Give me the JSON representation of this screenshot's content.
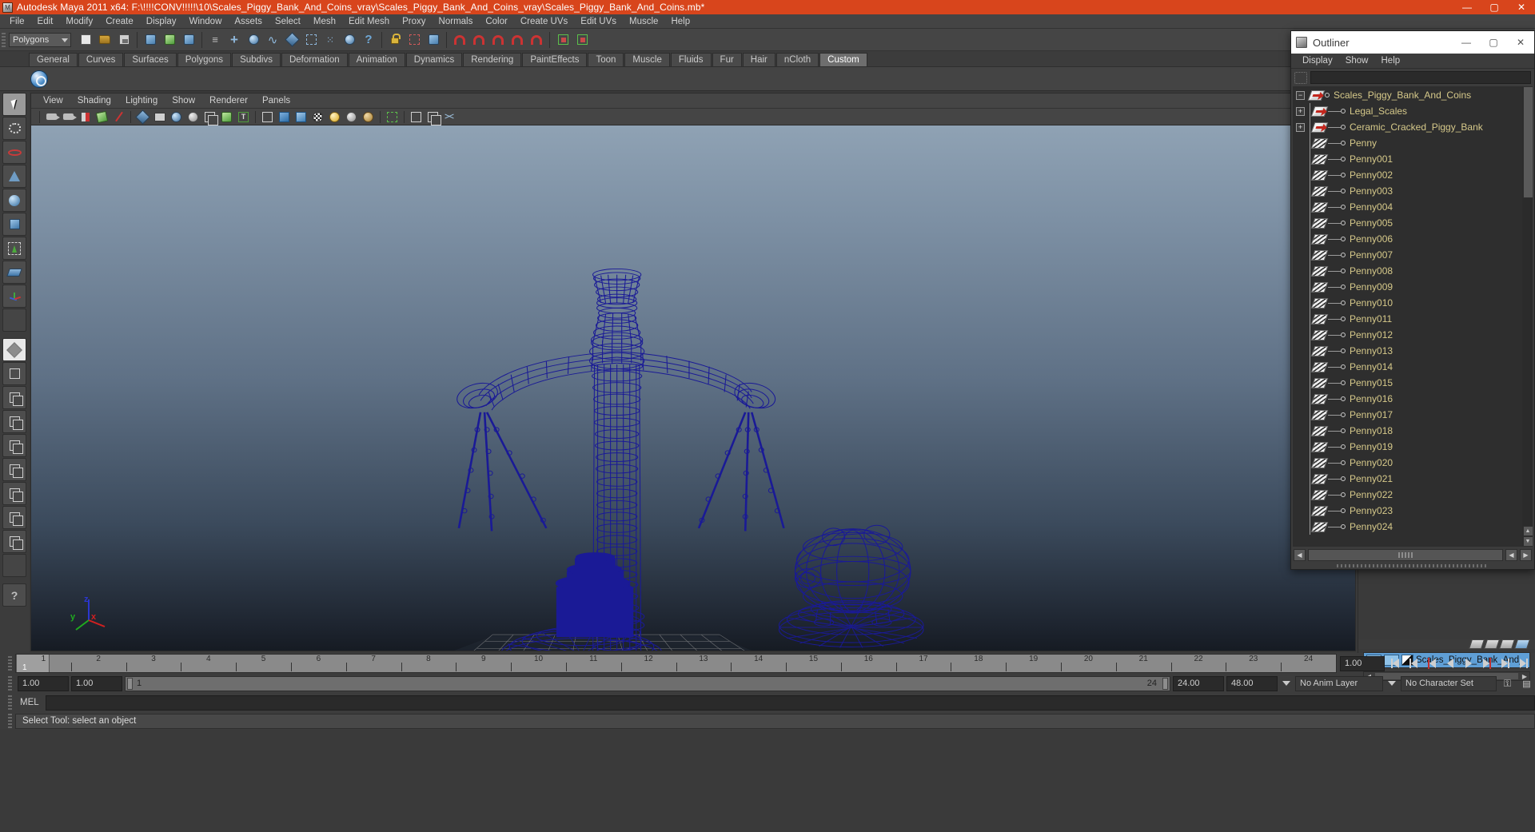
{
  "window": {
    "title": "Autodesk Maya 2011 x64: F:\\!!!!CONV!!!!!\\10\\Scales_Piggy_Bank_And_Coins_vray\\Scales_Piggy_Bank_And_Coins_vray\\Scales_Piggy_Bank_And_Coins.mb*",
    "minimize": "—",
    "maximize": "▢",
    "close": "✕",
    "accent_color": "#d8451c"
  },
  "menubar": {
    "items": [
      "File",
      "Edit",
      "Modify",
      "Create",
      "Display",
      "Window",
      "Assets",
      "Select",
      "Mesh",
      "Edit Mesh",
      "Proxy",
      "Normals",
      "Color",
      "Create UVs",
      "Edit UVs",
      "Muscle",
      "Help"
    ]
  },
  "statusbar": {
    "selection_mode": "Polygons",
    "icons": [
      "new-scene-icon",
      "open-scene-icon",
      "save-scene-icon",
      "select-hierarchy-icon",
      "select-object-icon",
      "select-component-icon",
      "select-filter-icon",
      "snap-grid-icon",
      "snap-curve-icon",
      "snap-point-icon",
      "snap-view-plane-icon",
      "construction-plane-icon",
      "make-live-icon",
      "render-globals-icon",
      "help-icon",
      "lock-icon",
      "highlight-selection-icon",
      "snap-magnet-grid-icon",
      "snap-magnet-curve-icon",
      "snap-magnet-point-icon",
      "snap-magnet-plane-icon",
      "snap-magnet-live-icon",
      "show-sidebar-icon",
      "show-channelbox-icon"
    ]
  },
  "shelf": {
    "tabs": [
      "General",
      "Curves",
      "Surfaces",
      "Polygons",
      "Subdivs",
      "Deformation",
      "Animation",
      "Dynamics",
      "Rendering",
      "PaintEffects",
      "Toon",
      "Muscle",
      "Fluids",
      "Fur",
      "Hair",
      "nCloth",
      "Custom"
    ],
    "active_tab": "Custom",
    "buttons": [
      "sphere-shelf-icon"
    ]
  },
  "toolbox": {
    "tools": [
      {
        "name": "select-tool",
        "selected": true
      },
      {
        "name": "lasso-select-tool",
        "selected": false
      },
      {
        "name": "paint-select-tool",
        "selected": false
      },
      {
        "name": "soft-modification-tool",
        "selected": false
      },
      {
        "name": "rotate-tool",
        "selected": false
      },
      {
        "name": "scale-tool",
        "selected": false
      },
      {
        "name": "universal-manipulator-tool",
        "selected": false
      },
      {
        "name": "move-tool",
        "selected": false
      },
      {
        "name": "show-manipulator-tool",
        "selected": false
      },
      {
        "name": "blank-tool-slot",
        "selected": false
      },
      {
        "name": "last-tool-used",
        "selected": false
      }
    ],
    "layout_presets": [
      "single-perspective-layout",
      "four-view-layout",
      "outliner-persp-layout",
      "hypergraph-persp-layout"
    ]
  },
  "viewport": {
    "menus": [
      "View",
      "Shading",
      "Lighting",
      "Show",
      "Renderer",
      "Panels"
    ],
    "toolbar_icons": [
      "select-camera-icon",
      "camera-attributes-icon",
      "bookmark-icon",
      "image-plane-icon",
      "keyframe-icon",
      "xray-shading-icon",
      "film-gate-icon",
      "resolution-gate-icon",
      "gate-mask-icon",
      "wireframe-on-shaded-icon",
      "texture-icon",
      "text-icon",
      "wireframe-icon",
      "smooth-shade-icon",
      "smooth-shade-textured-icon",
      "use-all-lights-icon",
      "light-yellow-icon",
      "light-grey-icon",
      "light-brown-icon",
      "isolate-select-icon",
      "xray-joints-icon",
      "single-pane-icon",
      "two-pane-icon",
      "shader-network-icon"
    ],
    "axis_labels": {
      "x": "x",
      "y": "y",
      "z": "z"
    },
    "axis_colors": {
      "x": "#d12020",
      "y": "#1faa1f",
      "z": "#2b36d0"
    },
    "model_wireframe_color": "#1a1a96",
    "background_gradient_top": "#8fa2b4",
    "background_gradient_bottom": "#161b23"
  },
  "timeline": {
    "ticks": [
      "1",
      "2",
      "3",
      "4",
      "5",
      "6",
      "7",
      "8",
      "9",
      "10",
      "11",
      "12",
      "13",
      "14",
      "15",
      "16",
      "17",
      "18",
      "19",
      "20",
      "21",
      "22",
      "23",
      "24"
    ],
    "current_frame": "1",
    "current_time_field": "1.00",
    "playback_buttons": [
      "go-to-start-icon",
      "step-back-keyframe-icon",
      "step-back-frame-icon",
      "play-backwards-icon",
      "play-forwards-icon",
      "step-forward-frame-icon",
      "step-forward-keyframe-icon",
      "go-to-end-icon"
    ]
  },
  "rangebar": {
    "range_start": "1.00",
    "range_end": "1.00",
    "slider_start_label": "1",
    "slider_end_label": "24",
    "anim_start": "24.00",
    "anim_end": "48.00",
    "anim_layer": "No Anim Layer",
    "character_set": "No Character Set",
    "icons": [
      "animation-preferences-icon",
      "auto-key-icon"
    ]
  },
  "command": {
    "label": "MEL",
    "input_value": "",
    "help_text": "Select Tool: select an object"
  },
  "layer_editor": {
    "layer_name": "Scales_Piggy_Bank_And_",
    "visibility_toggle": "V",
    "playback_toggle": "",
    "icons": [
      "layer-new-icon",
      "layer-new-selected-icon",
      "layer-template-icon",
      "layer-reference-icon"
    ]
  },
  "outliner": {
    "title": "Outliner",
    "minimize": "—",
    "maximize": "▢",
    "close": "✕",
    "menus": [
      "Display",
      "Show",
      "Help"
    ],
    "search_value": "",
    "search_placeholder": "",
    "items": [
      {
        "label": "Scales_Piggy_Bank_And_Coins",
        "depth": 0,
        "expander": "−",
        "icon": "transform-icon"
      },
      {
        "label": "Legal_Scales",
        "depth": 1,
        "expander": "+",
        "icon": "transform-icon"
      },
      {
        "label": "Ceramic_Cracked_Piggy_Bank",
        "depth": 1,
        "expander": "+",
        "icon": "transform-icon"
      },
      {
        "label": "Penny",
        "depth": 1,
        "expander": "",
        "icon": "mesh-icon"
      },
      {
        "label": "Penny001",
        "depth": 1,
        "expander": "",
        "icon": "mesh-icon"
      },
      {
        "label": "Penny002",
        "depth": 1,
        "expander": "",
        "icon": "mesh-icon"
      },
      {
        "label": "Penny003",
        "depth": 1,
        "expander": "",
        "icon": "mesh-icon"
      },
      {
        "label": "Penny004",
        "depth": 1,
        "expander": "",
        "icon": "mesh-icon"
      },
      {
        "label": "Penny005",
        "depth": 1,
        "expander": "",
        "icon": "mesh-icon"
      },
      {
        "label": "Penny006",
        "depth": 1,
        "expander": "",
        "icon": "mesh-icon"
      },
      {
        "label": "Penny007",
        "depth": 1,
        "expander": "",
        "icon": "mesh-icon"
      },
      {
        "label": "Penny008",
        "depth": 1,
        "expander": "",
        "icon": "mesh-icon"
      },
      {
        "label": "Penny009",
        "depth": 1,
        "expander": "",
        "icon": "mesh-icon"
      },
      {
        "label": "Penny010",
        "depth": 1,
        "expander": "",
        "icon": "mesh-icon"
      },
      {
        "label": "Penny011",
        "depth": 1,
        "expander": "",
        "icon": "mesh-icon"
      },
      {
        "label": "Penny012",
        "depth": 1,
        "expander": "",
        "icon": "mesh-icon"
      },
      {
        "label": "Penny013",
        "depth": 1,
        "expander": "",
        "icon": "mesh-icon"
      },
      {
        "label": "Penny014",
        "depth": 1,
        "expander": "",
        "icon": "mesh-icon"
      },
      {
        "label": "Penny015",
        "depth": 1,
        "expander": "",
        "icon": "mesh-icon"
      },
      {
        "label": "Penny016",
        "depth": 1,
        "expander": "",
        "icon": "mesh-icon"
      },
      {
        "label": "Penny017",
        "depth": 1,
        "expander": "",
        "icon": "mesh-icon"
      },
      {
        "label": "Penny018",
        "depth": 1,
        "expander": "",
        "icon": "mesh-icon"
      },
      {
        "label": "Penny019",
        "depth": 1,
        "expander": "",
        "icon": "mesh-icon"
      },
      {
        "label": "Penny020",
        "depth": 1,
        "expander": "",
        "icon": "mesh-icon"
      },
      {
        "label": "Penny021",
        "depth": 1,
        "expander": "",
        "icon": "mesh-icon"
      },
      {
        "label": "Penny022",
        "depth": 1,
        "expander": "",
        "icon": "mesh-icon"
      },
      {
        "label": "Penny023",
        "depth": 1,
        "expander": "",
        "icon": "mesh-icon"
      },
      {
        "label": "Penny024",
        "depth": 1,
        "expander": "",
        "icon": "mesh-icon"
      }
    ]
  }
}
